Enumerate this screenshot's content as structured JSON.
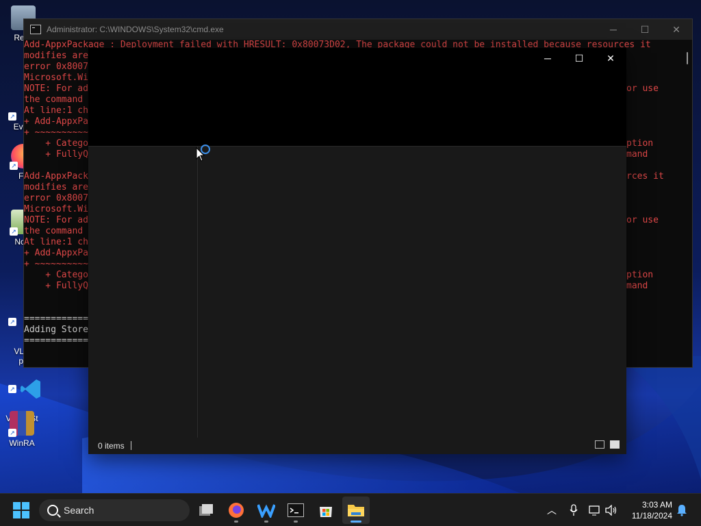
{
  "desktop": {
    "icons": [
      {
        "label": "Recy"
      },
      {
        "label": "Ever"
      },
      {
        "label": "Fir"
      },
      {
        "label": "Note"
      },
      {
        "label": "VLC\npl"
      },
      {
        "label": "Visual St\nCod"
      },
      {
        "label": "WinRA"
      }
    ]
  },
  "cmd": {
    "title": "Administrator: C:\\WINDOWS\\System32\\cmd.exe",
    "lines": [
      {
        "text": "Add-AppxPackage : Deployment failed with HRESULT: 0x80073D02, The package could not be installed because resources it",
        "cls": "err"
      },
      {
        "text": "modifies are",
        "right": "",
        "cls": "err"
      },
      {
        "text": "error 0x8007",
        "cls": "err"
      },
      {
        "text": "Microsoft.Wi",
        "cls": "err"
      },
      {
        "text": "NOTE: For ad",
        "right": "or use",
        "cls": "err"
      },
      {
        "text": "the command ",
        "cls": "err"
      },
      {
        "text": "At line:1 ch",
        "cls": "err"
      },
      {
        "text": "+ Add-AppxPa",
        "cls": "err"
      },
      {
        "text": "+ ~~~~~~~~~~",
        "cls": "err"
      },
      {
        "text": "    + Catego",
        "right": "ption",
        "cls": "err"
      },
      {
        "text": "    + FullyQ",
        "right": "mand",
        "cls": "err"
      },
      {
        "text": "",
        "cls": "err"
      },
      {
        "text": "Add-AppxPack",
        "right": "rces it",
        "cls": "err"
      },
      {
        "text": "modifies are",
        "cls": "err"
      },
      {
        "text": "error 0x8007",
        "cls": "err"
      },
      {
        "text": "Microsoft.Wi",
        "cls": "err"
      },
      {
        "text": "NOTE: For ad",
        "right": "or use",
        "cls": "err"
      },
      {
        "text": "the command ",
        "cls": "err"
      },
      {
        "text": "At line:1 ch",
        "cls": "err"
      },
      {
        "text": "+ Add-AppxPa",
        "cls": "err"
      },
      {
        "text": "+ ~~~~~~~~~~",
        "cls": "err"
      },
      {
        "text": "    + Catego",
        "right": "ption",
        "cls": "err"
      },
      {
        "text": "    + FullyQ",
        "right": "mand",
        "cls": "err"
      },
      {
        "text": "",
        "cls": "out"
      },
      {
        "text": "",
        "cls": "out"
      },
      {
        "text": "============",
        "cls": "out"
      },
      {
        "text": "Adding Store",
        "cls": "out"
      },
      {
        "text": "============",
        "cls": "out"
      }
    ]
  },
  "explorer": {
    "status_count": "0 items"
  },
  "taskbar": {
    "search_label": "Search",
    "apps": [
      "file-stack",
      "firefox",
      "app-w",
      "terminal",
      "microsoft-store",
      "file-explorer"
    ],
    "time": "3:03 AM",
    "date": "11/18/2024"
  },
  "colors": {
    "error_text": "#e04848",
    "accent": "#5ab0ff"
  }
}
